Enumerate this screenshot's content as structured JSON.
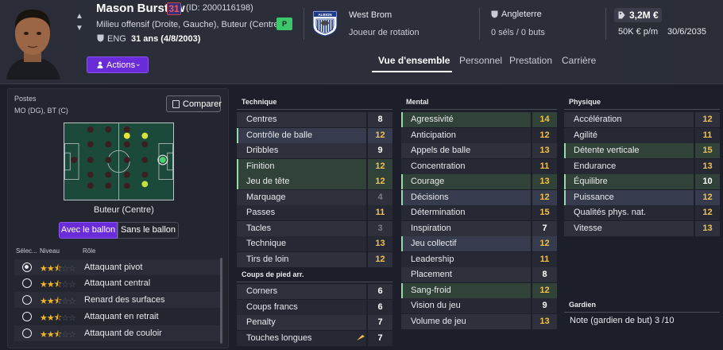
{
  "header": {
    "name": "Mason Burstow",
    "number": "31",
    "player_id": "(ID: 2000116198)",
    "positions": "Milieu offensif (Droite, Gauche), Buteur (Centre)",
    "nationality": "ENG",
    "age": "31 ans (4/8/2003)",
    "p_badge": "P",
    "club": "West Brom",
    "club_role": "Joueur de rotation",
    "intl_country": "Angleterre",
    "intl_stats": "0 séls / 0 buts",
    "value": "3,2M €",
    "wage": "50K € p/m",
    "contract_end": "30/6/2035",
    "actions_label": "Actions",
    "crest_text": "ALBION"
  },
  "tabs": [
    "Vue d'ensemble",
    "Personnel",
    "Prestation",
    "Carrière"
  ],
  "left": {
    "postes_label": "Postes",
    "postes_value": "MO (DG), BT (C)",
    "compare_label": "Comparer",
    "role_name": "Buteur (Centre)",
    "seg_with": "Avec le ballon",
    "seg_without": "Sans le ballon",
    "col_select": "Sélec...",
    "col_level": "Niveau",
    "col_role": "Rôle",
    "roles": [
      {
        "label": "Attaquant pivot",
        "stars": 2.5,
        "selected": true
      },
      {
        "label": "Attaquant central",
        "stars": 2.5,
        "selected": false
      },
      {
        "label": "Renard des surfaces",
        "stars": 2.5,
        "selected": false
      },
      {
        "label": "Attaquant en retrait",
        "stars": 2.5,
        "selected": false
      },
      {
        "label": "Attaquant de couloir",
        "stars": 2.5,
        "selected": false
      }
    ]
  },
  "technique": {
    "title": "Technique",
    "rows": [
      {
        "name": "Centres",
        "value": "8"
      },
      {
        "name": "Contrôle de balle",
        "value": "12"
      },
      {
        "name": "Dribbles",
        "value": "9"
      },
      {
        "name": "Finition",
        "value": "12"
      },
      {
        "name": "Jeu de tête",
        "value": "12"
      },
      {
        "name": "Marquage",
        "value": "4"
      },
      {
        "name": "Passes",
        "value": "11"
      },
      {
        "name": "Tacles",
        "value": "3"
      },
      {
        "name": "Technique",
        "value": "13"
      },
      {
        "name": "Tirs de loin",
        "value": "12"
      }
    ]
  },
  "set_pieces": {
    "title": "Coups de pied arr.",
    "rows": [
      {
        "name": "Corners",
        "value": "6"
      },
      {
        "name": "Coups francs",
        "value": "6"
      },
      {
        "name": "Penalty",
        "value": "7"
      },
      {
        "name": "Touches longues",
        "value": "7"
      }
    ]
  },
  "mental": {
    "title": "Mental",
    "rows": [
      {
        "name": "Agressivité",
        "value": "14"
      },
      {
        "name": "Anticipation",
        "value": "12"
      },
      {
        "name": "Appels de balle",
        "value": "13"
      },
      {
        "name": "Concentration",
        "value": "11"
      },
      {
        "name": "Courage",
        "value": "13"
      },
      {
        "name": "Décisions",
        "value": "12"
      },
      {
        "name": "Détermination",
        "value": "15"
      },
      {
        "name": "Inspiration",
        "value": "7"
      },
      {
        "name": "Jeu collectif",
        "value": "12"
      },
      {
        "name": "Leadership",
        "value": "11"
      },
      {
        "name": "Placement",
        "value": "8"
      },
      {
        "name": "Sang-froid",
        "value": "12"
      },
      {
        "name": "Vision du jeu",
        "value": "9"
      },
      {
        "name": "Volume de jeu",
        "value": "13"
      }
    ]
  },
  "physique": {
    "title": "Physique",
    "rows": [
      {
        "name": "Accélération",
        "value": "12"
      },
      {
        "name": "Agilité",
        "value": "11"
      },
      {
        "name": "Détente verticale",
        "value": "15"
      },
      {
        "name": "Endurance",
        "value": "13"
      },
      {
        "name": "Équilibre",
        "value": "10"
      },
      {
        "name": "Puissance",
        "value": "12"
      },
      {
        "name": "Qualités phys. nat.",
        "value": "12"
      },
      {
        "name": "Vitesse",
        "value": "13"
      }
    ]
  },
  "goalkeeper": {
    "title": "Gardien",
    "note": "Note (gardien de but)  3 /10"
  },
  "colors": {
    "accent_purple": "#6a2bd9",
    "value_yellow": "#f2c14e",
    "highlight_green": "#314338",
    "p_badge_green": "#3cc76a"
  }
}
